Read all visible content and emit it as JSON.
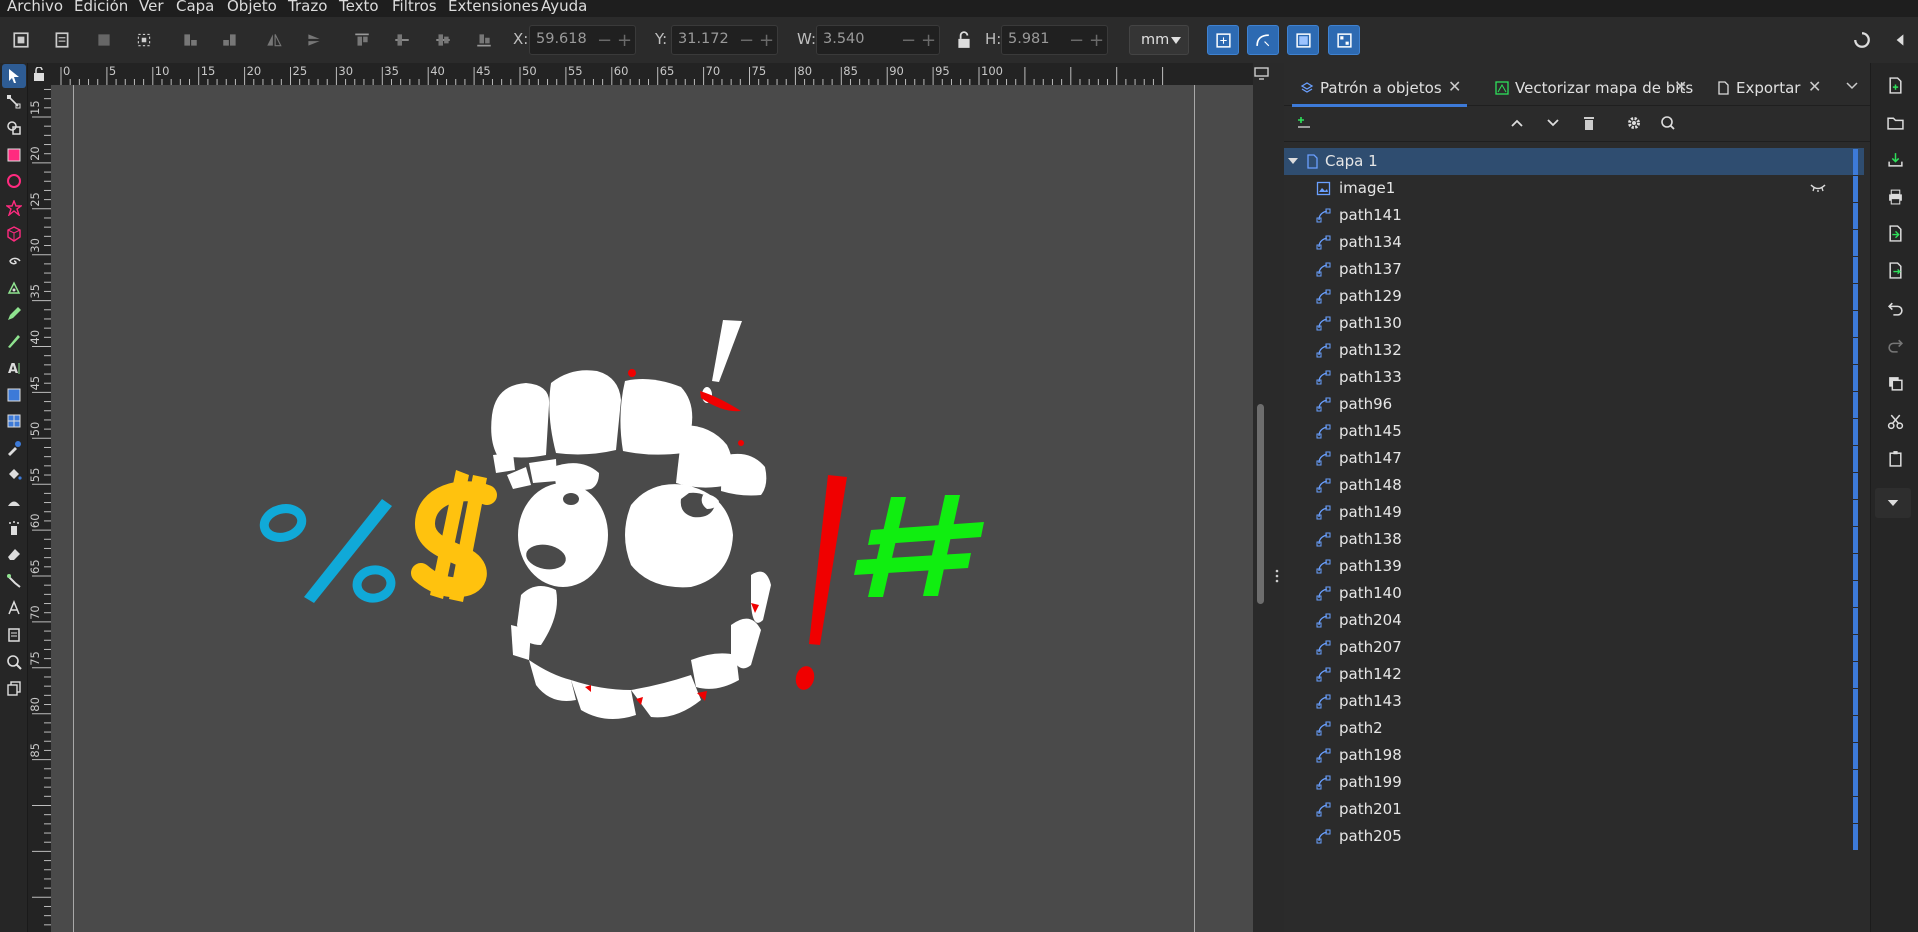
{
  "menubar": {
    "items": [
      "Archivo",
      "Edición",
      "Ver",
      "Capa",
      "Objeto",
      "Trazo",
      "Texto",
      "Filtros",
      "Extensiones",
      "Ayuda"
    ]
  },
  "toolbar": {
    "x_label": "X:",
    "x_value": "59.618",
    "y_label": "Y:",
    "y_value": "31.172",
    "w_label": "W:",
    "w_value": "3.540",
    "h_label": "H:",
    "h_value": "5.981",
    "unit": "mm",
    "minus": "−",
    "plus": "+"
  },
  "ruler_top": {
    "ticks": [
      "0",
      "5",
      "10",
      "15",
      "20",
      "25",
      "30",
      "35",
      "40",
      "45",
      "50",
      "55",
      "60",
      "65",
      "70",
      "75",
      "80",
      "85",
      "90",
      "95",
      "100"
    ]
  },
  "ruler_left": {
    "ticks": [
      "15",
      "20",
      "25",
      "30",
      "35",
      "40",
      "45",
      "50",
      "55",
      "60",
      "65",
      "70",
      "75",
      "80",
      "85"
    ]
  },
  "panel": {
    "tabs": [
      {
        "label": "Patrón a objetos",
        "close": "✕"
      },
      {
        "label": "Vectorizar mapa de bits",
        "close": "✕"
      },
      {
        "label": "Exportar",
        "close": "✕"
      }
    ],
    "layer": {
      "label": "Capa 1"
    },
    "objects": [
      "image1",
      "path141",
      "path134",
      "path137",
      "path129",
      "path130",
      "path132",
      "path133",
      "path96",
      "path145",
      "path147",
      "path148",
      "path149",
      "path138",
      "path139",
      "path140",
      "path204",
      "path207",
      "path142",
      "path143",
      "path2",
      "path198",
      "path199",
      "path201",
      "path205"
    ]
  },
  "canvas": {
    "glyphs": {
      "percent": "%",
      "dollar": "$",
      "exclaim": "!",
      "hash": "#"
    },
    "colors": {
      "percent": "#10a9d8",
      "dollar": "#ffc20e",
      "exclaim": "#f00000",
      "hash": "#10ee10",
      "teeth": "#ffffff",
      "background": "#4a4a4a"
    }
  },
  "colors": {
    "accent": "#2d6ab2",
    "selection": "#2f4d70",
    "marker": "#3d7ad8"
  }
}
